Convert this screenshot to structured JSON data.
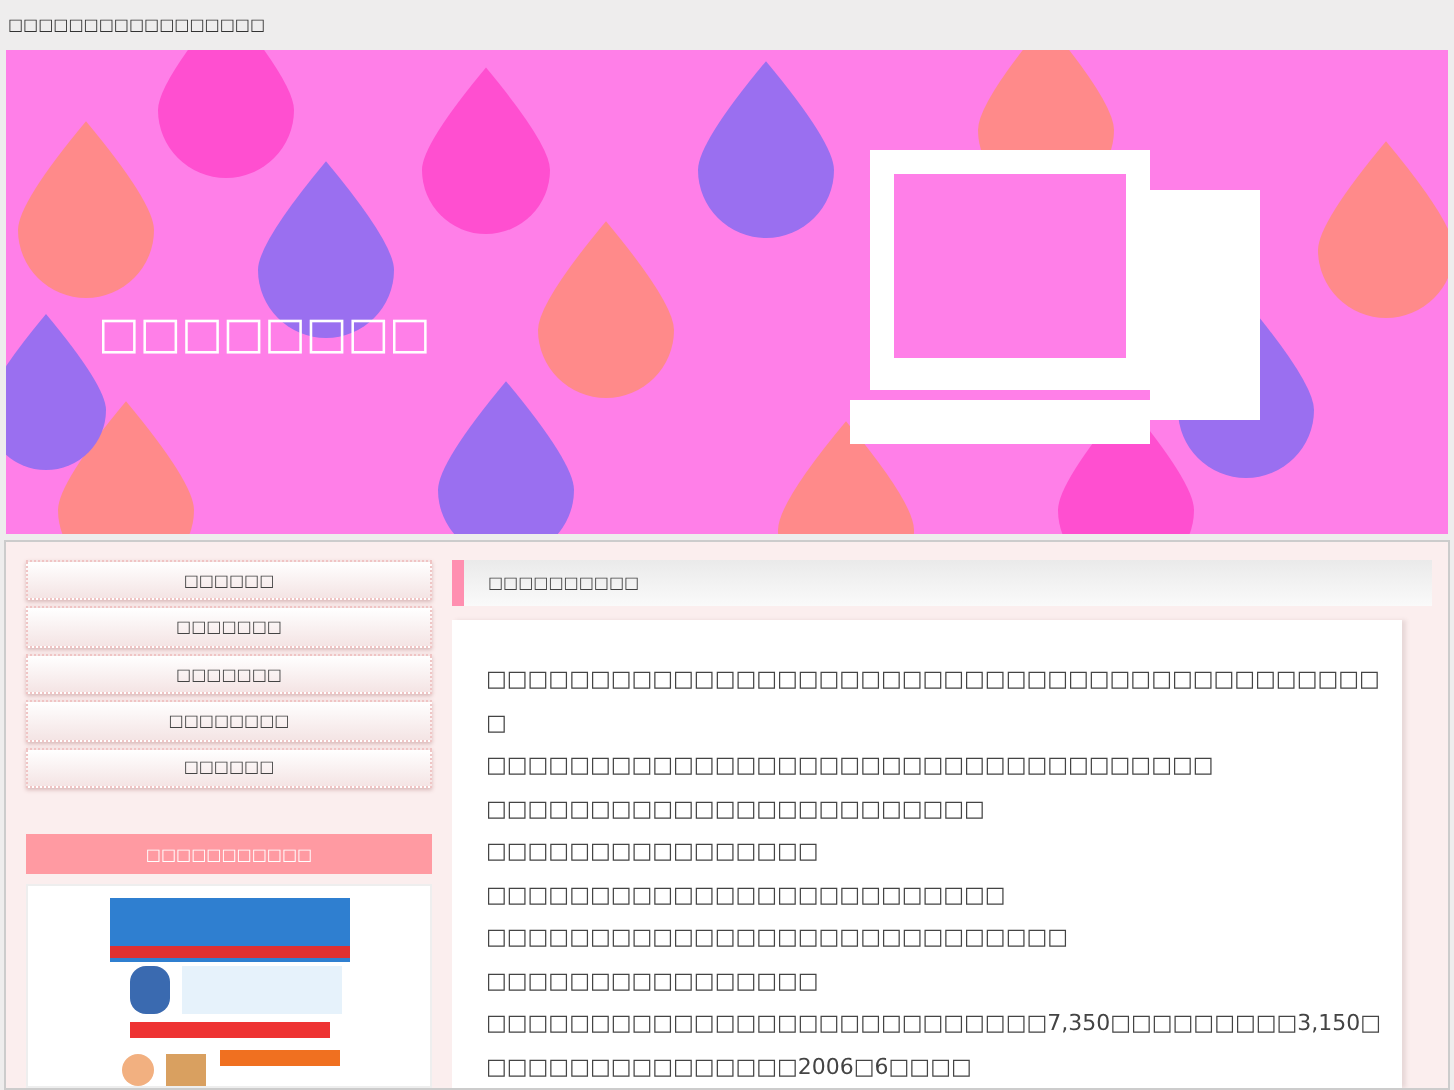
{
  "page_title": "□□□□□□□□□□□□□□□□□",
  "header": {
    "title": "□□□□□□□□"
  },
  "nav": [
    "□□□□□□",
    "□□□□□□□",
    "□□□□□□□",
    "□□□□□□□□",
    "□□□□□□"
  ],
  "sidebar_heading": "□□□□□□□□□□□",
  "section_heading": "□□□□□□□□□□",
  "paragraphs": [
    "□□□□□□□□□□□□□□□□□□□□□□□□□□□□□□□□□□□□□□□□□□□□",
    "□□□□□□□□□□□□□□□□□□□□□□□□□□□□□□□□□□□",
    "□□□□□□□□□□□□□□□□□□□□□□□□",
    "□□□□□□□□□□□□□□□□",
    "□□□□□□□□□□□□□□□□□□□□□□□□□",
    "□□□□□□□□□□□□□□□□□□□□□□□□□□□□",
    "□□□□□□□□□□□□□□□□",
    "□□□□□□□□□□□□□□□□□□□□□□□□□□□7,350□□□□□□□□□3,150□□□□□□□□□□□□□□□□2006□6□□□□"
  ]
}
